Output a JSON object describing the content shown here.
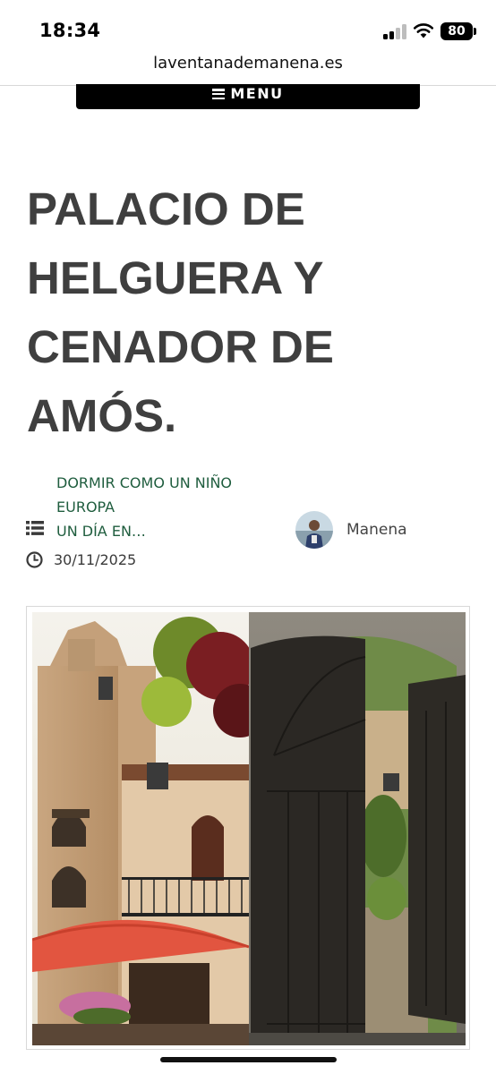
{
  "status_bar": {
    "time": "18:34",
    "battery": "80",
    "icons": [
      "signal-icon",
      "wifi-icon",
      "battery-icon"
    ]
  },
  "browser": {
    "url": "laventanademanena.es"
  },
  "nav": {
    "menu_label": "MENU",
    "menu_icon": "hamburger-icon"
  },
  "post": {
    "title_lines": [
      "PALACIO DE",
      "HELGUERA Y",
      "CENADOR DE",
      "AMÓS."
    ],
    "categories": [
      "DORMIR COMO UN NIÑO",
      "EUROPA",
      "UN DÍA EN…"
    ],
    "author": "Manena",
    "date": "30/11/2025",
    "icons": [
      "category-list-icon",
      "clock-icon",
      "author-avatar"
    ]
  },
  "colors": {
    "link_green": "#1f5d3e",
    "title_gray": "#3f3f3f",
    "menu_bg": "#000000"
  }
}
